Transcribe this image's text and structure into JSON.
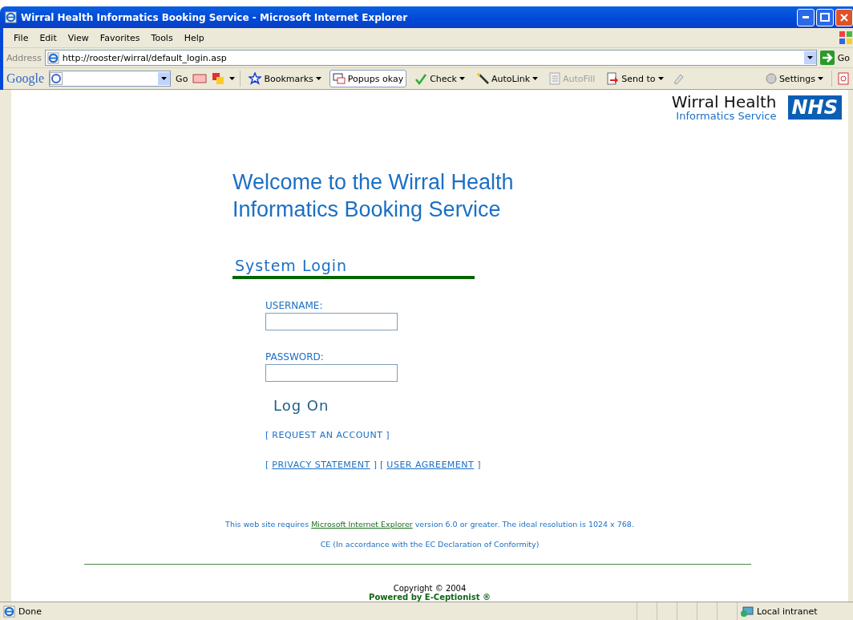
{
  "window": {
    "title": "Wirral Health Informatics Booking Service - Microsoft Internet Explorer"
  },
  "menu": [
    "File",
    "Edit",
    "View",
    "Favorites",
    "Tools",
    "Help"
  ],
  "address_bar": {
    "label": "Address",
    "url": "http://rooster/wirral/default_login.asp",
    "go": "Go"
  },
  "google_toolbar": {
    "brand": "Google",
    "go": "Go",
    "items": [
      {
        "label": "Bookmarks",
        "caret": true,
        "pressed": false,
        "disabled": false
      },
      {
        "label": "Popups okay",
        "caret": false,
        "pressed": true,
        "disabled": false
      },
      {
        "label": "Check",
        "caret": true,
        "pressed": false,
        "disabled": false
      },
      {
        "label": "AutoLink",
        "caret": true,
        "pressed": false,
        "disabled": false
      },
      {
        "label": "AutoFill",
        "caret": false,
        "pressed": false,
        "disabled": true
      },
      {
        "label": "Send to",
        "caret": true,
        "pressed": false,
        "disabled": false
      }
    ],
    "settings": "Settings"
  },
  "logo": {
    "name": "Wirral Health",
    "subtitle": "Informatics Service",
    "badge": "NHS"
  },
  "welcome": "Welcome to the Wirral Health Informatics Booking Service",
  "login": {
    "heading": "System Login",
    "username_label": "USERNAME:",
    "password_label": "PASSWORD:",
    "button": "Log On",
    "request": {
      "open": "[",
      "link": "REQUEST AN ACCOUNT",
      "close": "]"
    },
    "legal": [
      {
        "open": "[",
        "link": "PRIVACY STATEMENT",
        "close": "]"
      },
      {
        "open": "[",
        "link": "USER AGREEMENT",
        "close": "]"
      }
    ]
  },
  "footer": {
    "requirement": {
      "before": "This web site requires",
      "link": "Microsoft Internet Explorer",
      "after": "version 6.0 or greater. The ideal resolution is 1024 x 768."
    },
    "conformity": "CE (In accordance with the EC Declaration of Conformity)",
    "copyright": "Copyright © 2004",
    "powered": "Powered by E-Ceptionist ®"
  },
  "status_bar": {
    "text": "Done",
    "zone": "Local intranet"
  }
}
